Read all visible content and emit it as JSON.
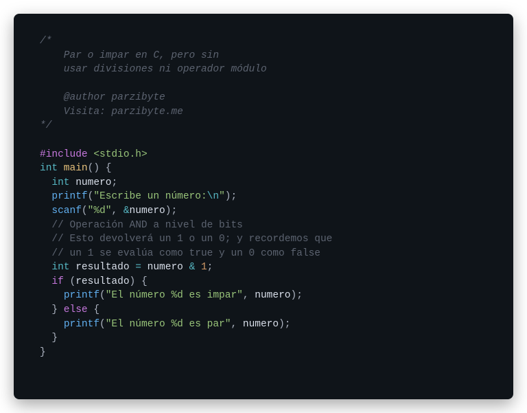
{
  "code": {
    "c1": "/*",
    "c2": "    Par o impar en C, pero sin",
    "c3": "    usar divisiones ni operador módulo",
    "c4": "",
    "c5": "    @author parzibyte",
    "c6": "    Visita: parzibyte.me",
    "c7": "*/",
    "include_kw": "#include",
    "include_hdr": " <stdio.h>",
    "int_kw": "int",
    "main_name": " main",
    "main_parens": "()",
    "brace_open": " {",
    "decl_int": "int",
    "decl_name": " numero",
    "semi": ";",
    "printf_name": "printf",
    "lparen": "(",
    "rparen": ")",
    "str1_a": "\"Escribe un número:",
    "str1_esc": "\\n",
    "str1_b": "\"",
    "scanf_name": "scanf",
    "str2": "\"%d\"",
    "comma_sp": ", ",
    "amp": "&",
    "numero_ref": "numero",
    "lc1": "// Operación AND a nivel de bits",
    "lc2": "// Esto devolverá un 1 o un 0; y recordemos que",
    "lc3": "// un 1 se evalúa como true y un 0 como false",
    "res_name": " resultado ",
    "eq": "=",
    "sp_numero": " numero ",
    "andop": "&",
    "sp1": " 1",
    "if_kw": "if",
    "sp_lparen": " (",
    "res_ref": "resultado",
    "rparen_brace": ") {",
    "str3": "\"El número %d es impar\"",
    "numero_arg": "numero",
    "close_brace": "}",
    "else_kw": " else ",
    "open_brace2": "{",
    "str4": "\"El número %d es par\"",
    "close_brace2": "}",
    "final_brace": "}",
    "indent2": "  ",
    "indent4": "    "
  }
}
